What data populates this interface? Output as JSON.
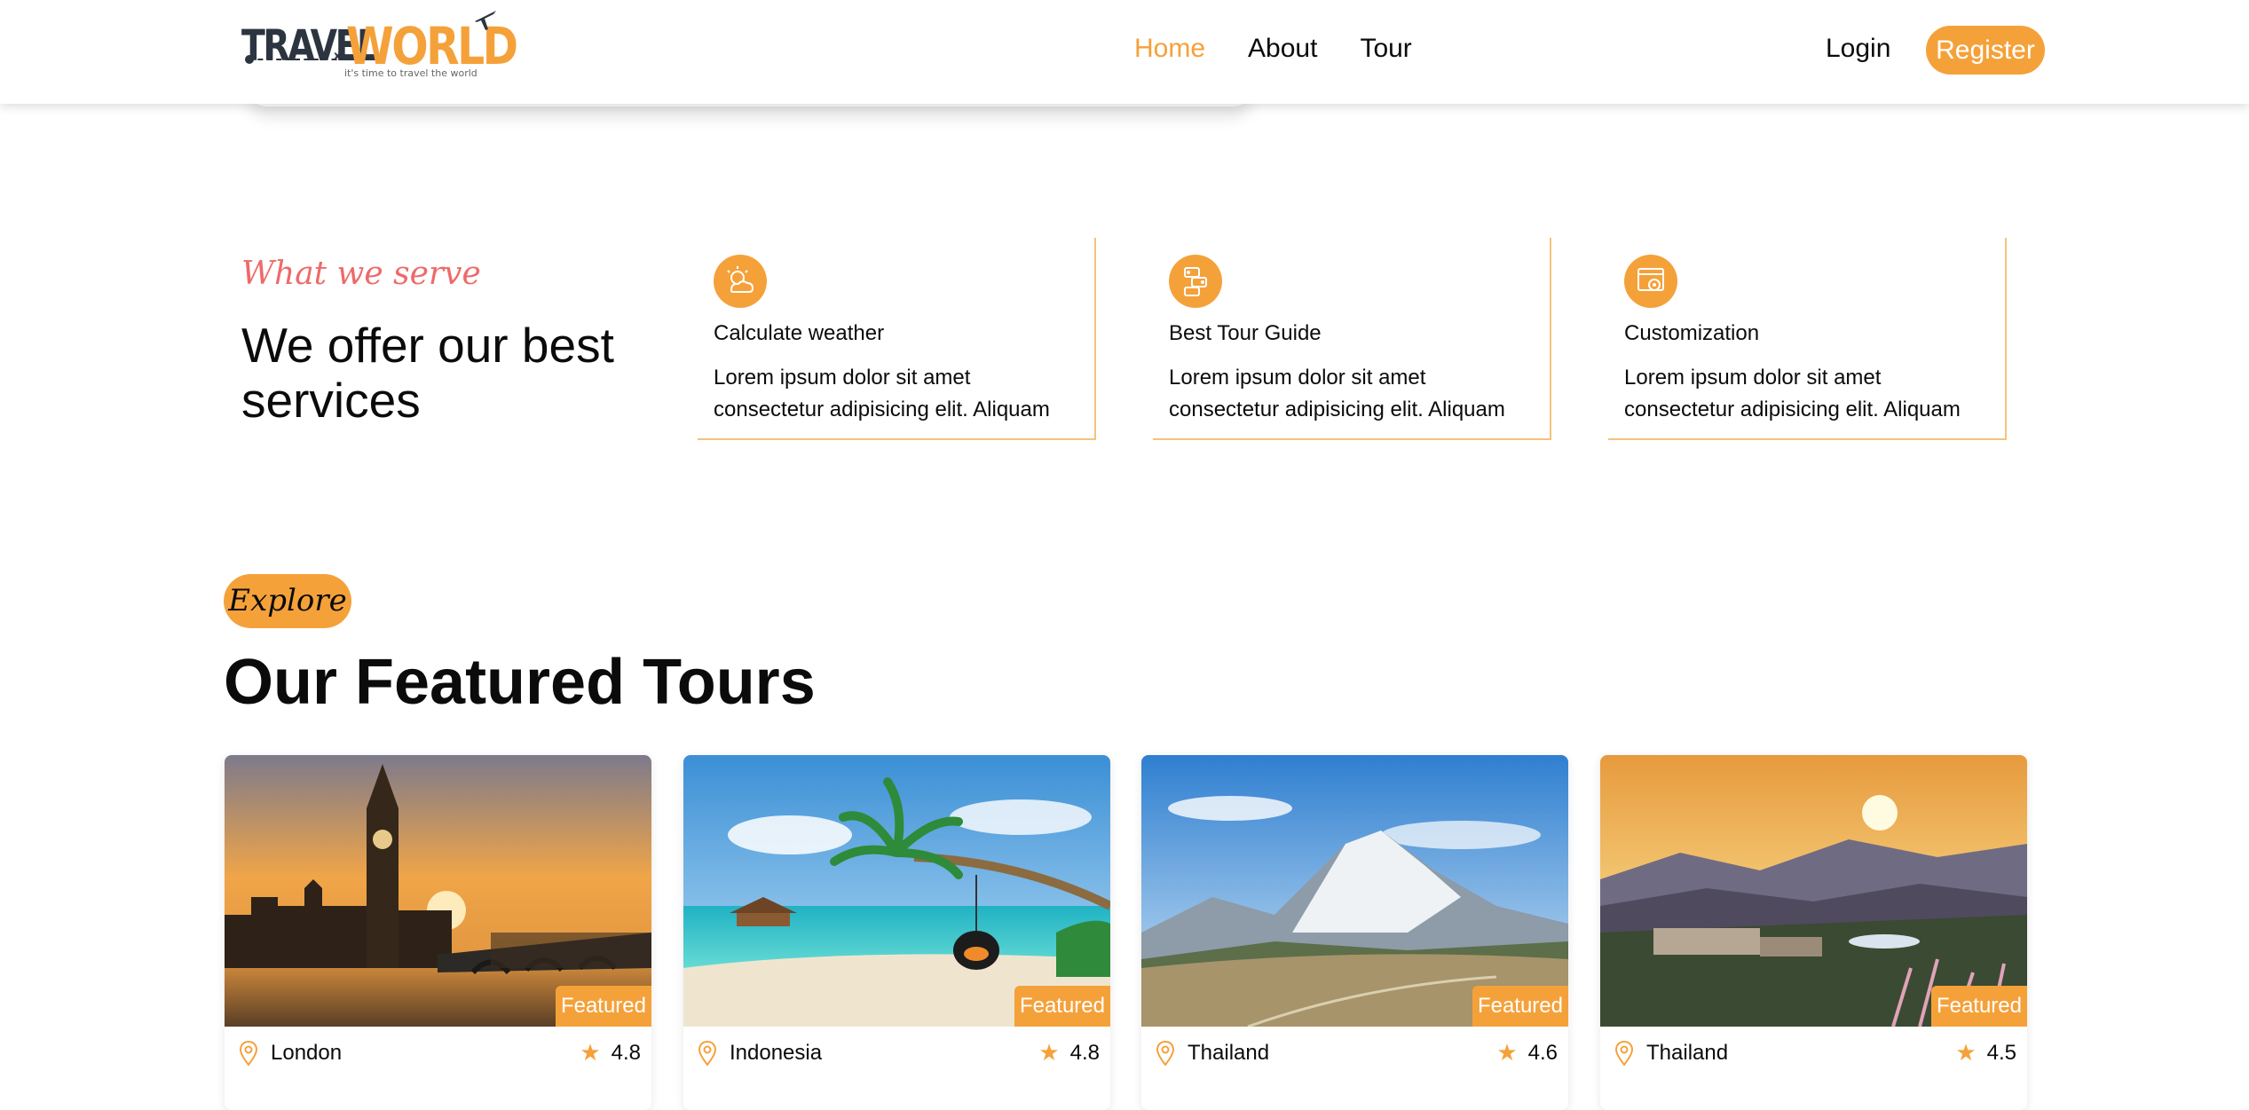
{
  "brand": {
    "name_part1": "TRAVEL",
    "name_part2": "WORLD",
    "tagline": "it's time to travel the world",
    "accent_color": "#f5a13a",
    "dark_color": "#2c3440"
  },
  "nav": {
    "items": [
      {
        "label": "Home",
        "active": true
      },
      {
        "label": "About",
        "active": false
      },
      {
        "label": "Tour",
        "active": false
      }
    ],
    "login_label": "Login",
    "register_label": "Register"
  },
  "services": {
    "subtitle": "What we serve",
    "title": "We offer our best services",
    "items": [
      {
        "icon": "weather-icon",
        "title": "Calculate weather",
        "desc": "Lorem ipsum dolor sit amet consectetur adipisicing elit. Aliquam"
      },
      {
        "icon": "guide-icon",
        "title": "Best Tour Guide",
        "desc": "Lorem ipsum dolor sit amet consectetur adipisicing elit. Aliquam"
      },
      {
        "icon": "customization-icon",
        "title": "Customization",
        "desc": "Lorem ipsum dolor sit amet consectetur adipisicing elit. Aliquam"
      }
    ]
  },
  "featured": {
    "pill": "Explore",
    "title": "Our Featured Tours",
    "badge_label": "Featured",
    "tours": [
      {
        "location": "London",
        "rating": "4.8",
        "image": "london-big-ben-photo"
      },
      {
        "location": "Indonesia",
        "rating": "4.8",
        "image": "tropical-beach-photo"
      },
      {
        "location": "Thailand",
        "rating": "4.6",
        "image": "mountain-photo"
      },
      {
        "location": "Thailand",
        "rating": "4.5",
        "image": "sunset-resort-photo"
      }
    ]
  }
}
